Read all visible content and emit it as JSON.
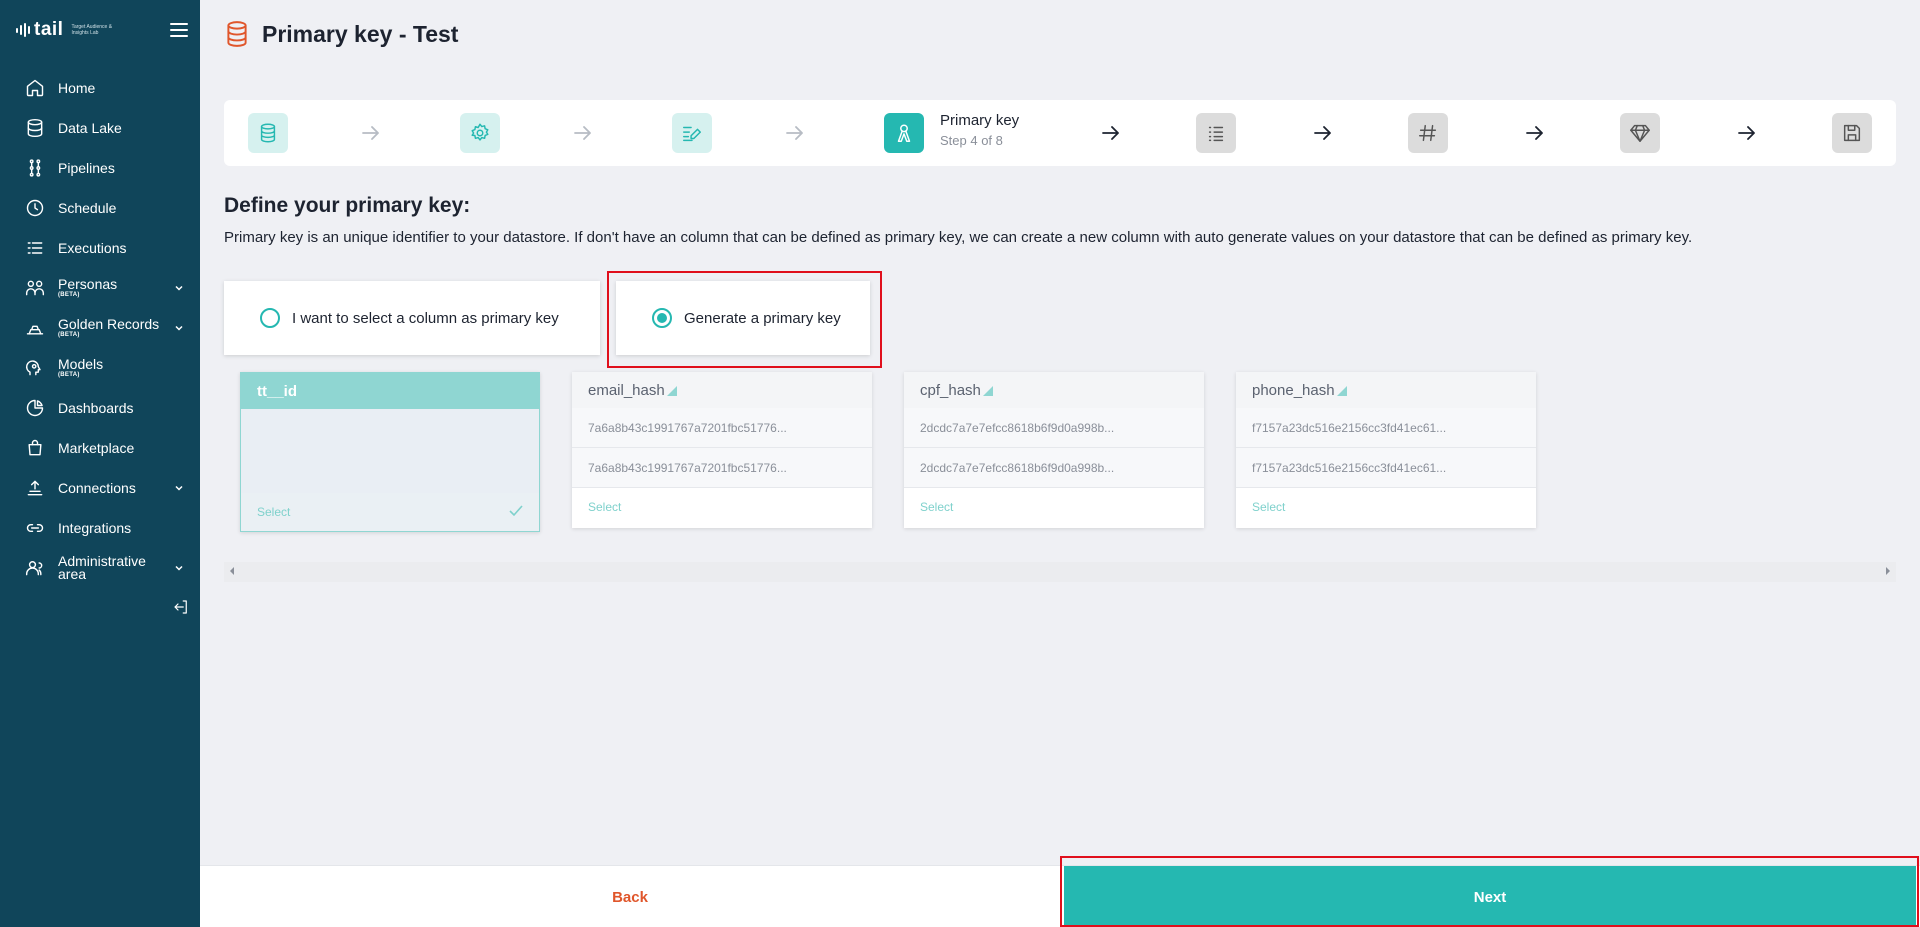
{
  "app": {
    "logo_word": "tail",
    "logo_sub": "Target Audience & Insights Lab"
  },
  "sidebar": {
    "items": [
      {
        "label": "Home",
        "icon": "home-icon",
        "badge": "",
        "expandable": false
      },
      {
        "label": "Data Lake",
        "icon": "database-icon",
        "badge": "",
        "expandable": false
      },
      {
        "label": "Pipelines",
        "icon": "pipeline-icon",
        "badge": "",
        "expandable": false
      },
      {
        "label": "Schedule",
        "icon": "clock-icon",
        "badge": "",
        "expandable": false
      },
      {
        "label": "Executions",
        "icon": "list-icon",
        "badge": "",
        "expandable": false
      },
      {
        "label": "Personas",
        "icon": "people-icon",
        "badge": "(BETA)",
        "expandable": true
      },
      {
        "label": "Golden Records",
        "icon": "gold-bars-icon",
        "badge": "(BETA)",
        "expandable": true
      },
      {
        "label": "Models",
        "icon": "brain-icon",
        "badge": "(BETA)",
        "expandable": false
      },
      {
        "label": "Dashboards",
        "icon": "pie-chart-icon",
        "badge": "",
        "expandable": false
      },
      {
        "label": "Marketplace",
        "icon": "shopping-bag-icon",
        "badge": "",
        "expandable": false
      },
      {
        "label": "Connections",
        "icon": "upload-box-icon",
        "badge": "",
        "expandable": true
      },
      {
        "label": "Integrations",
        "icon": "link-icon",
        "badge": "",
        "expandable": false
      },
      {
        "label": "Administrative area",
        "icon": "admin-users-icon",
        "badge": "",
        "expandable": true
      }
    ]
  },
  "header": {
    "title": "Primary key - Test",
    "icon": "database-icon",
    "icon_color": "#e0562b"
  },
  "stepper": {
    "current_name": "Primary key",
    "current_count": "Step 4 of 8",
    "steps": [
      "database-icon",
      "gear-icon",
      "edit-list-icon",
      "primary-key-icon",
      "checklist-icon",
      "hash-icon",
      "diamond-icon",
      "save-icon"
    ]
  },
  "main": {
    "title": "Define your primary key:",
    "description": "Primary key is an unique identifier to your datastore. If don't have an column that can be defined as primary key, we can create a new column with auto generate values on your datastore that can be defined as primary key.",
    "options": [
      {
        "label": "I want to select a column as primary key",
        "selected": false
      },
      {
        "label": "Generate a primary key",
        "selected": true
      }
    ],
    "columns": [
      {
        "name": "tt__id",
        "rows": [],
        "select_label": "Select",
        "selected": true
      },
      {
        "name": "email_hash",
        "rows": [
          "7a6a8b43c1991767a7201fbc51776...",
          "7a6a8b43c1991767a7201fbc51776..."
        ],
        "select_label": "Select",
        "selected": false
      },
      {
        "name": "cpf_hash",
        "rows": [
          "2dcdc7a7e7efcc8618b6f9d0a998b...",
          "2dcdc7a7e7efcc8618b6f9d0a998b..."
        ],
        "select_label": "Select",
        "selected": false
      },
      {
        "name": "phone_hash",
        "rows": [
          "f7157a23dc516e2156cc3fd41ec61...",
          "f7157a23dc516e2156cc3fd41ec61..."
        ],
        "select_label": "Select",
        "selected": false
      }
    ]
  },
  "footer": {
    "back_label": "Back",
    "next_label": "Next"
  },
  "colors": {
    "sidebar_bg": "#10455a",
    "accent": "#25b8b1",
    "back_text": "#e0562b",
    "highlight": "#e00f1c"
  }
}
